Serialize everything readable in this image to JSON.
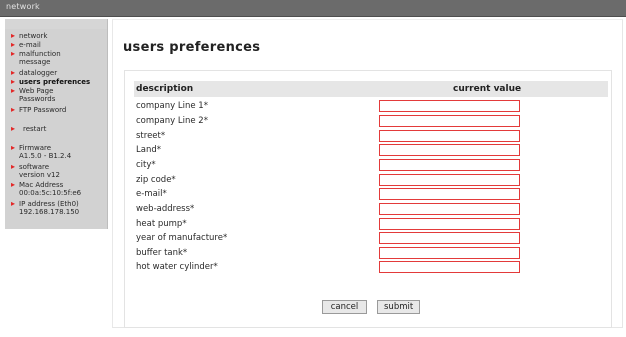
{
  "topbar": {
    "title": "network"
  },
  "sidebar": {
    "items": [
      {
        "label": "network"
      },
      {
        "label": "e-mail"
      },
      {
        "label": "malfunction\nmessage"
      },
      {
        "label": "datalogger"
      },
      {
        "label": "users preferences"
      },
      {
        "label": "Web Page\nPasswords"
      },
      {
        "label": "FTP Password"
      },
      {
        "label": "restart"
      },
      {
        "label": "Firmware\nA1.5.0 - B1.2.4"
      },
      {
        "label": "software\nversion v12"
      },
      {
        "label": "Mac Address\n00:0a:5c:10:5f:e6"
      },
      {
        "label": "IP address (Eth0)\n192.168.178.150"
      }
    ]
  },
  "main": {
    "title": "users preferences",
    "table": {
      "col_description": "description",
      "col_value": "current value",
      "rows": [
        {
          "label": "company Line 1*",
          "value": ""
        },
        {
          "label": "company Line 2*",
          "value": ""
        },
        {
          "label": "street*",
          "value": ""
        },
        {
          "label": "Land*",
          "value": ""
        },
        {
          "label": "city*",
          "value": ""
        },
        {
          "label": "zip code*",
          "value": ""
        },
        {
          "label": "e-mail*",
          "value": ""
        },
        {
          "label": "web-address*",
          "value": ""
        },
        {
          "label": "heat pump*",
          "value": ""
        },
        {
          "label": "year of manufacture*",
          "value": ""
        },
        {
          "label": "buffer tank*",
          "value": ""
        },
        {
          "label": "hot water cylinder*",
          "value": ""
        }
      ]
    },
    "buttons": {
      "cancel": "cancel",
      "submit": "submit"
    }
  },
  "colors": {
    "bullet": "#e32626",
    "input_border": "#e33a3a",
    "sidebar_bg": "#d2d2d2",
    "topbar_bg": "#6b6b6b"
  }
}
